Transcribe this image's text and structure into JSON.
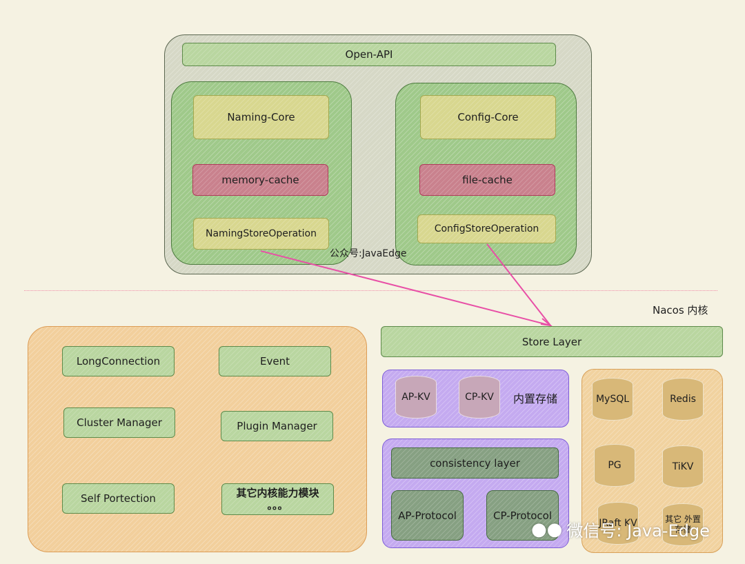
{
  "top": {
    "open_api": "Open-API",
    "naming": {
      "core": "Naming-Core",
      "cache": "memory-cache",
      "store": "NamingStoreOperation"
    },
    "config": {
      "core": "Config-Core",
      "cache": "file-cache",
      "store": "ConfigStoreOperation"
    },
    "watermark": "公众号:JavaEdge"
  },
  "kernel_label": "Nacos 内核",
  "store_layer": "Store Layer",
  "builtin": {
    "label": "内置存储",
    "ap": "AP-KV",
    "cp": "CP-KV"
  },
  "consistency": {
    "layer": "consistency layer",
    "ap": "AP-Protocol",
    "cp": "CP-Protocol"
  },
  "external": [
    "MySQL",
    "Redis",
    "PG",
    "TiKV",
    "JRaft KV",
    "其它 外置存储"
  ],
  "modules": [
    "LongConnection",
    "Event",
    "Cluster Manager",
    "Plugin Manager",
    "Self Portection",
    "其它内核能力模块",
    "。。。"
  ],
  "footer_watermark": "微信号: Java-Edge",
  "colors": {
    "arrow": "#e84fa6",
    "divider": "#f08aa8"
  }
}
